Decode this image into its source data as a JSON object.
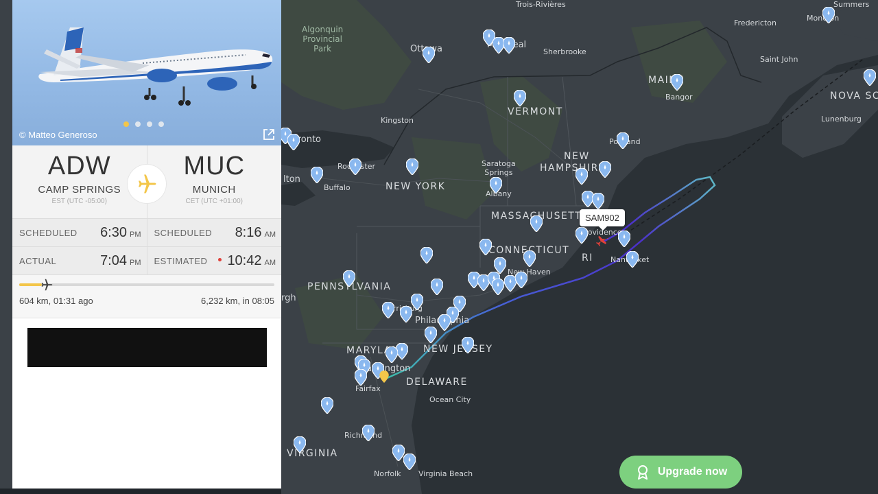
{
  "flight": {
    "photo_credit": "© Matteo Generoso",
    "photo_count": 4,
    "photo_active_index": 0,
    "origin": {
      "code": "ADW",
      "city": "CAMP SPRINGS",
      "tz": "EST (UTC -05:00)"
    },
    "destination": {
      "code": "MUC",
      "city": "MUNICH",
      "tz": "CET (UTC +01:00)"
    },
    "departure": {
      "scheduled_label": "SCHEDULED",
      "scheduled_time": "6:30",
      "scheduled_ampm": "PM",
      "actual_label": "ACTUAL",
      "actual_time": "7:04",
      "actual_ampm": "PM"
    },
    "arrival": {
      "scheduled_label": "SCHEDULED",
      "scheduled_time": "8:16",
      "scheduled_ampm": "AM",
      "estimated_label": "ESTIMATED",
      "estimated_time": "10:42",
      "estimated_ampm": "AM"
    },
    "progress_fraction": 0.09,
    "flown": "604 km, 01:31 ago",
    "remaining": "6,232 km, in 08:05"
  },
  "map": {
    "callsign": "SAM902",
    "upgrade_label": "Upgrade now",
    "labels": {
      "vermont": "VERMONT",
      "new_york": "NEW YORK",
      "new": "NEW",
      "hampshire": "HAMPSHIRE",
      "maine": "MAINE",
      "massachusetts": "MASSACHUSETTS",
      "connecticut": "CONNECTICUT",
      "ri": "RI",
      "pennsylvania": "PENNSYLVANIA",
      "new_jersey": "NEW JERSEY",
      "maryland": "MARYLAND",
      "delaware": "DELAWARE",
      "virginia": "VIRGINIA",
      "nova_scotia": "NOVA SC",
      "algonquin_1": "Algonquin",
      "algonquin_2": "Provincial",
      "algonquin_3": "Park",
      "ottawa": "Ottawa",
      "montreal": "Montreal",
      "sherbrooke": "Sherbrooke",
      "trois_rivieres": "Trois-Rivières",
      "fredericton": "Fredericton",
      "saint_john": "Saint John",
      "bangor": "Bangor",
      "lunenburg": "Lunenburg",
      "moncton": "Moncton",
      "summerside": "Summers",
      "kingston": "Kingston",
      "toronto": "Toronto",
      "rochester": "Rochester",
      "buffalo": "Buffalo",
      "saratoga_1": "Saratoga",
      "saratoga_2": "Springs",
      "albany": "Albany",
      "portland": "Portland",
      "providence": "Providence",
      "new_haven": "New Haven",
      "nantucket": "Nantucket",
      "harrisburg": "Harrisburg",
      "philadelphia": "Philadelphia",
      "pittsburgh": "rgh",
      "washington": "Washington",
      "fairfax": "Fairfax",
      "ocean_city": "Ocean City",
      "richmond": "Richmond",
      "norfolk": "Norfolk",
      "virginia_beach": "Virginia Beach",
      "hamilton": "lton",
      "new_y": "N"
    }
  },
  "colors": {
    "accent_yellow": "#f3c64a",
    "track_start": "#3fbfaa",
    "track_end": "#4b2fc9",
    "upgrade_green": "#7dd07f",
    "pin_blue": "#8ab8ef"
  },
  "icons": [
    "plane-icon",
    "share-icon",
    "location-pin-icon",
    "award-icon"
  ]
}
